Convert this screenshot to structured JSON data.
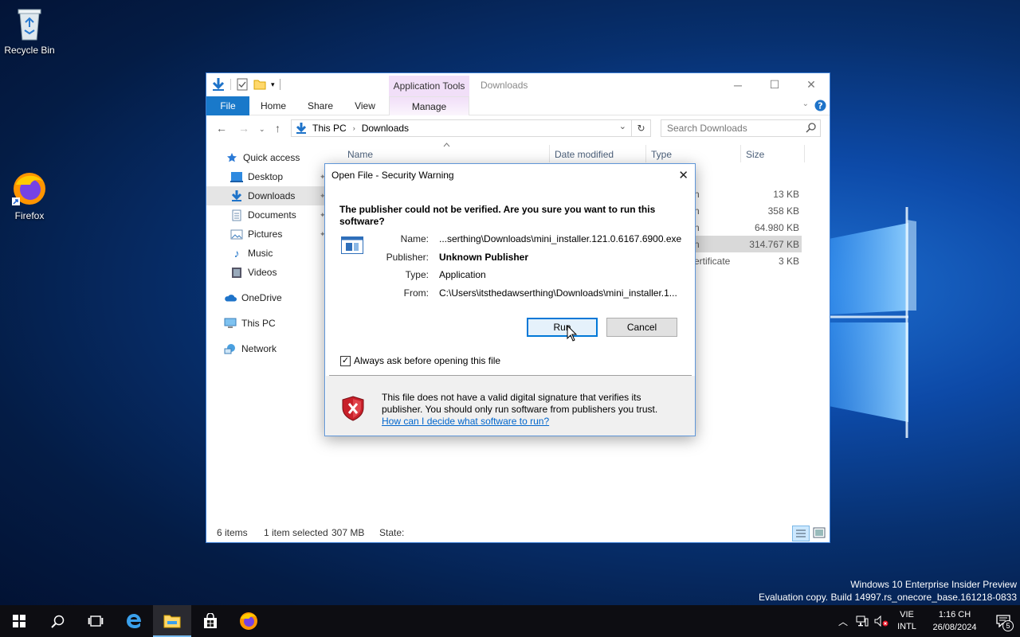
{
  "desktop": {
    "icons": [
      {
        "label": "Recycle Bin",
        "icon": "recycle-bin-icon"
      },
      {
        "label": "Firefox",
        "icon": "firefox-icon"
      }
    ],
    "watermark": {
      "line1": "Windows 10 Enterprise Insider Preview",
      "line2": "Evaluation copy. Build 14997.rs_onecore_base.161218-0833"
    }
  },
  "explorer": {
    "title": "Downloads",
    "contextual_tab": "Application Tools",
    "ribbon_tabs": [
      "File",
      "Home",
      "Share",
      "View",
      "Manage"
    ],
    "breadcrumb": [
      "This PC",
      "Downloads"
    ],
    "search_placeholder": "Search Downloads",
    "nav": {
      "quick_access": "Quick access",
      "items": [
        "Desktop",
        "Downloads",
        "Documents",
        "Pictures",
        "Music",
        "Videos"
      ],
      "onedrive": "OneDrive",
      "this_pc": "This PC",
      "network": "Network"
    },
    "columns": {
      "name": "Name",
      "date": "Date modified",
      "type": "Type",
      "size": "Size"
    },
    "rows": [
      {
        "type_fragment": "n",
        "size": "13 KB"
      },
      {
        "type_fragment": "n",
        "size": "358 KB"
      },
      {
        "type_fragment": "n",
        "size": "64.980 KB"
      },
      {
        "type_fragment": "n",
        "size": "314.767 KB",
        "selected": true
      },
      {
        "type_fragment": "ertificate",
        "size": "3 KB"
      }
    ],
    "status": {
      "items": "6 items",
      "selected": "1 item selected",
      "size": "307 MB",
      "state": "State:"
    }
  },
  "dialog": {
    "title": "Open File - Security Warning",
    "question": "The publisher could not be verified.  Are you sure you want to run this software?",
    "fields": {
      "name_label": "Name:",
      "name_value": "...serthing\\Downloads\\mini_installer.121.0.6167.6900.exe",
      "publisher_label": "Publisher:",
      "publisher_value": "Unknown Publisher",
      "type_label": "Type:",
      "type_value": "Application",
      "from_label": "From:",
      "from_value": "C:\\Users\\itsthedawserthing\\Downloads\\mini_installer.1..."
    },
    "run_label": "Run",
    "cancel_label": "Cancel",
    "checkbox_label": "Always ask before opening this file",
    "checkbox_checked": true,
    "warning_text": "This file does not have a valid digital signature that verifies its publisher.  You should only run software from publishers you trust.",
    "warning_link": "How can I decide what software to run?"
  },
  "taskbar": {
    "apps": [
      "start-icon",
      "search-icon",
      "task-view-icon",
      "edge-icon",
      "file-explorer-icon",
      "store-icon",
      "firefox-icon"
    ],
    "lang_line1": "VIE",
    "lang_line2": "INTL",
    "time": "1:16 CH",
    "date": "26/08/2024",
    "notifications": "5"
  },
  "colors": {
    "accent": "#0078d7",
    "file_tab": "#1979ca",
    "context_tab": "#f1dff8"
  }
}
